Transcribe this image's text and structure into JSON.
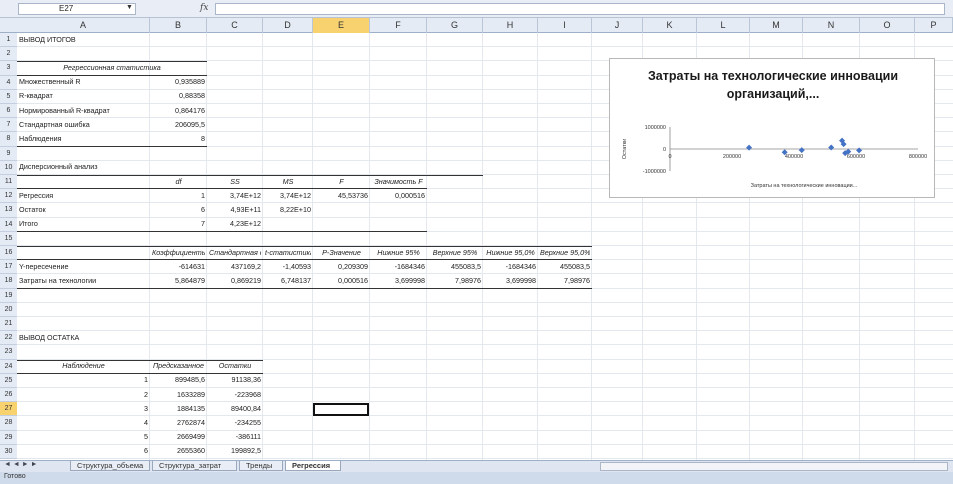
{
  "formula_bar": {
    "name_box": "E27",
    "fx": "fx",
    "formula": ""
  },
  "columns": [
    "A",
    "B",
    "C",
    "D",
    "E",
    "F",
    "G",
    "H",
    "I",
    "J",
    "K",
    "L",
    "M",
    "N",
    "O",
    "P"
  ],
  "active_column": "E",
  "active_row": 27,
  "rows": [
    "1",
    "2",
    "3",
    "4",
    "5",
    "6",
    "7",
    "8",
    "9",
    "10",
    "11",
    "12",
    "13",
    "14",
    "15",
    "16",
    "17",
    "18",
    "19",
    "20",
    "21",
    "22",
    "23",
    "24",
    "25",
    "26",
    "27",
    "28",
    "29",
    "30"
  ],
  "sheet": {
    "r1": "ВЫВОД ИТОГОВ",
    "regr_header": "Регрессионная статистика",
    "regr_stats": [
      {
        "label": "Множественный R",
        "value": "0,935889"
      },
      {
        "label": "R-квадрат",
        "value": "0,88358"
      },
      {
        "label": "Нормированный R-квадрат",
        "value": "0,864176"
      },
      {
        "label": "Стандартная ошибка",
        "value": "206095,5"
      },
      {
        "label": "Наблюдения",
        "value": "8"
      }
    ],
    "anova_title": "Дисперсионный анализ",
    "anova_headers": [
      "df",
      "SS",
      "MS",
      "F",
      "Значимость F"
    ],
    "anova_rows": [
      {
        "label": "Регрессия",
        "df": "1",
        "ss": "3,74E+12",
        "ms": "3,74E+12",
        "f": "45,53736",
        "sig": "0,000516"
      },
      {
        "label": "Остаток",
        "df": "6",
        "ss": "4,93E+11",
        "ms": "8,22E+10",
        "f": "",
        "sig": ""
      },
      {
        "label": "Итого",
        "df": "7",
        "ss": "4,23E+12",
        "ms": "",
        "f": "",
        "sig": ""
      }
    ],
    "coef_headers": [
      "Коэффициенты",
      "Стандартная ошибка",
      "t-статистика",
      "P-Значение",
      "Нижние 95%",
      "Верхние 95%",
      "Нижние 95,0%",
      "Верхние 95,0%"
    ],
    "coef_rows": [
      {
        "label": "Y-пересечение",
        "vals": [
          "-614631",
          "437169,2",
          "-1,40593",
          "0,209309",
          "-1684346",
          "455083,5",
          "-1684346",
          "455083,5"
        ]
      },
      {
        "label": "Затраты на технологии",
        "vals": [
          "5,864879",
          "0,869219",
          "6,748137",
          "0,000516",
          "3,699998",
          "7,98976",
          "3,699998",
          "7,98976"
        ]
      }
    ],
    "resid_title": "ВЫВОД ОСТАТКА",
    "resid_headers": [
      "Наблюдение",
      "Предсказанное",
      "Остатки"
    ],
    "resid_rows": [
      {
        "n": "1",
        "pred": "899485,6",
        "res": "91138,36"
      },
      {
        "n": "2",
        "pred": "1633289",
        "res": "-223968"
      },
      {
        "n": "3",
        "pred": "1884135",
        "res": "89400,84"
      },
      {
        "n": "4",
        "pred": "2762874",
        "res": "-234255"
      },
      {
        "n": "5",
        "pred": "2669499",
        "res": "-386111"
      },
      {
        "n": "6",
        "pred": "2655360",
        "res": "199892,5"
      }
    ]
  },
  "chart_data": {
    "type": "scatter",
    "title": "Затраты на технологические инновации организаций,...",
    "xlabel": "Затраты на технологические инновации...",
    "ylabel": "Остатки",
    "xlim": [
      0,
      800000
    ],
    "ylim": [
      -1000000,
      1000000
    ],
    "xticks": [
      "0",
      "200000",
      "400000",
      "600000",
      "800000"
    ],
    "yticks": [
      "1000000",
      "0",
      "-1000000"
    ],
    "x": [
      255000,
      370000,
      425000,
      520000,
      555000,
      560000,
      565000,
      575000,
      610000
    ],
    "y": [
      60000,
      -150000,
      -50000,
      70000,
      380000,
      220000,
      -190000,
      -120000,
      -60000
    ],
    "color": "#4472c4",
    "grid": false,
    "legend": "none"
  },
  "tabs": {
    "nav": "◄ ◄ ► ►",
    "items": [
      "Структура_объема",
      "Структура_затрат",
      "Тренды",
      "Регрессия"
    ],
    "active": "Регрессия"
  },
  "status": {
    "text": "Готово"
  }
}
